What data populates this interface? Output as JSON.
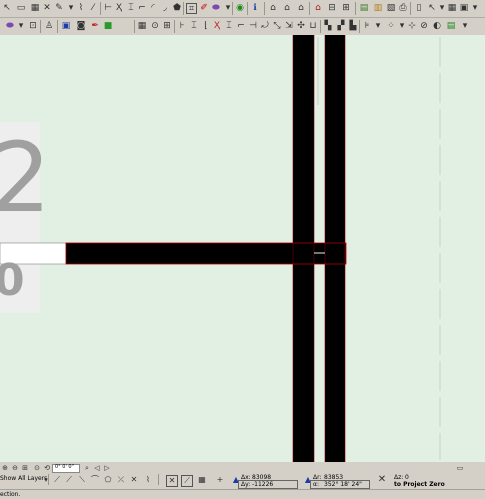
{
  "canvas": {
    "label_digit_large": "2",
    "label_digit_small": "0"
  },
  "zoom": {
    "angle_value": "0° 0' 0\""
  },
  "layers": {
    "show_all_label": "Show All Layers"
  },
  "coords": {
    "ax_label": "Δx:",
    "ax_value": "83098",
    "ay_label": "Δy:",
    "ay_value": "-11226",
    "ar_label": "Δr:",
    "ar_value": "83853",
    "aa_label": "α:",
    "aa_value": "352° 18' 24\"",
    "az_label": "Δz:",
    "az_value": "0",
    "project_zero": "to Project Zero"
  },
  "status": {
    "message": "ection."
  }
}
